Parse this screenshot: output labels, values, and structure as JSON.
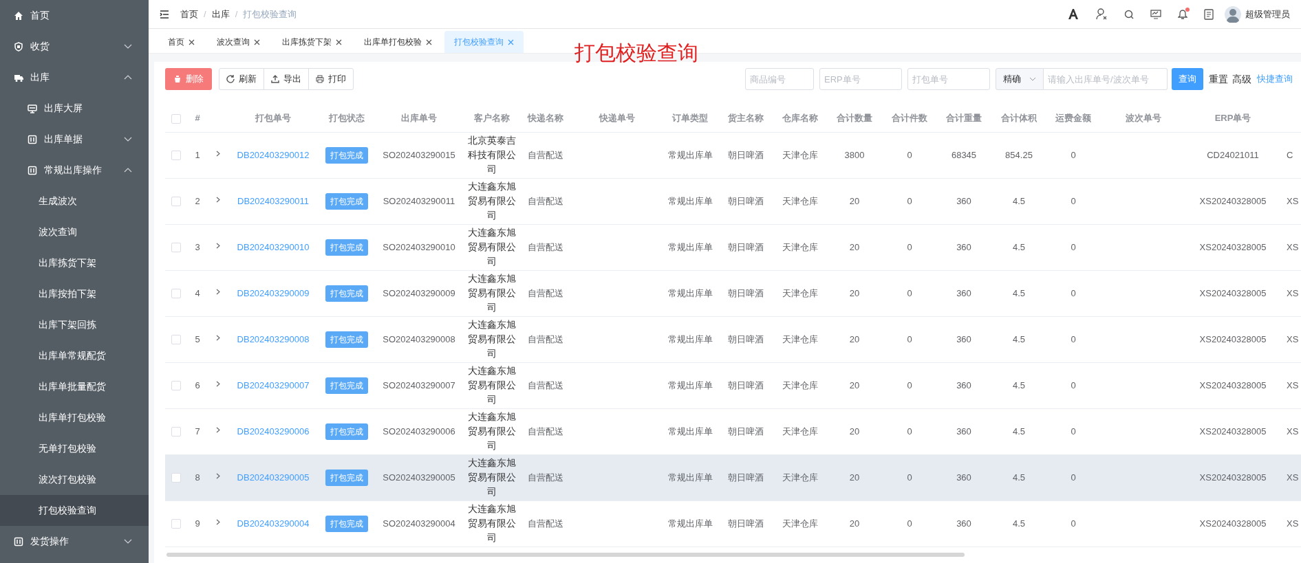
{
  "sidebar": {
    "items": [
      {
        "label": "首页"
      },
      {
        "label": "收货",
        "expanded": false
      },
      {
        "label": "出库",
        "expanded": true,
        "children": [
          {
            "label": "出库大屏"
          },
          {
            "label": "出库单据",
            "expanded": false
          },
          {
            "label": "常规出库操作",
            "expanded": true,
            "children": [
              {
                "label": "生成波次",
                "selected": false
              },
              {
                "label": "波次查询",
                "selected": false
              },
              {
                "label": "出库拣货下架",
                "selected": false
              },
              {
                "label": "出库按拍下架",
                "selected": false
              },
              {
                "label": "出库下架回拣",
                "selected": false
              },
              {
                "label": "出库单常规配货",
                "selected": false
              },
              {
                "label": "出库单批量配货",
                "selected": false
              },
              {
                "label": "出库单打包校验",
                "selected": false
              },
              {
                "label": "无单打包校验",
                "selected": false
              },
              {
                "label": "波次打包校验",
                "selected": false
              },
              {
                "label": "打包校验查询",
                "selected": true
              }
            ]
          }
        ]
      },
      {
        "label": "发货操作",
        "expanded": false
      }
    ]
  },
  "breadcrumb": [
    "首页",
    "出库",
    "打包校验查询"
  ],
  "breadcrumb_separator": "/",
  "user": {
    "name": "超级管理员",
    "notification": true
  },
  "tabs": [
    {
      "label": "首页",
      "selected": false
    },
    {
      "label": "波次查询",
      "selected": false
    },
    {
      "label": "出库拣货下架",
      "selected": false
    },
    {
      "label": "出库单打包校验",
      "selected": false
    },
    {
      "label": "打包校验查询",
      "selected": true
    }
  ],
  "annotation": "打包校验查询",
  "toolbar": {
    "delete": "删除",
    "refresh": "刷新",
    "export": "导出",
    "print": "打印"
  },
  "filters": {
    "product_no": {
      "placeholder": "商品编号"
    },
    "erp_no": {
      "placeholder": "ERP单号"
    },
    "pack_no": {
      "placeholder": "打包单号"
    },
    "match_mode": "精确",
    "keyword": {
      "placeholder": "请输入出库单号/波次单号"
    },
    "search": "查询",
    "reset": "重置",
    "advanced": "高级",
    "quick": "快捷查询"
  },
  "table": {
    "all_checked": false,
    "columns": [
      "#",
      "打包单号",
      "打包状态",
      "出库单号",
      "客户名称",
      "快递名称",
      "快递单号",
      "订单类型",
      "货主名称",
      "仓库名称",
      "合计数量",
      "合计件数",
      "合计重量",
      "合计体积",
      "运费金额",
      "波次单号",
      "ERP单号"
    ],
    "rows": [
      {
        "checked": false,
        "expanded": false,
        "hovered": false,
        "cells": [
          "1",
          "DB202403290012",
          "打包完成",
          "SO202403290015",
          "北京英泰吉科技有限公司",
          "自营配送",
          "",
          "常规出库单",
          "朝日啤酒",
          "天津仓库",
          "3800",
          "0",
          "68345",
          "854.25",
          "0",
          "",
          "CD24021011",
          "C"
        ]
      },
      {
        "checked": false,
        "expanded": false,
        "hovered": false,
        "cells": [
          "2",
          "DB202403290011",
          "打包完成",
          "SO202403290011",
          "大连鑫东旭贸易有限公司",
          "自营配送",
          "",
          "常规出库单",
          "朝日啤酒",
          "天津仓库",
          "20",
          "0",
          "360",
          "4.5",
          "0",
          "",
          "XS20240328005",
          "XS"
        ]
      },
      {
        "checked": false,
        "expanded": false,
        "hovered": false,
        "cells": [
          "3",
          "DB202403290010",
          "打包完成",
          "SO202403290010",
          "大连鑫东旭贸易有限公司",
          "自营配送",
          "",
          "常规出库单",
          "朝日啤酒",
          "天津仓库",
          "20",
          "0",
          "360",
          "4.5",
          "0",
          "",
          "XS20240328005",
          "XS"
        ]
      },
      {
        "checked": false,
        "expanded": false,
        "hovered": false,
        "cells": [
          "4",
          "DB202403290009",
          "打包完成",
          "SO202403290009",
          "大连鑫东旭贸易有限公司",
          "自营配送",
          "",
          "常规出库单",
          "朝日啤酒",
          "天津仓库",
          "20",
          "0",
          "360",
          "4.5",
          "0",
          "",
          "XS20240328005",
          "XS"
        ]
      },
      {
        "checked": false,
        "expanded": false,
        "hovered": false,
        "cells": [
          "5",
          "DB202403290008",
          "打包完成",
          "SO202403290008",
          "大连鑫东旭贸易有限公司",
          "自营配送",
          "",
          "常规出库单",
          "朝日啤酒",
          "天津仓库",
          "20",
          "0",
          "360",
          "4.5",
          "0",
          "",
          "XS20240328005",
          "XS"
        ]
      },
      {
        "checked": false,
        "expanded": false,
        "hovered": false,
        "cells": [
          "6",
          "DB202403290007",
          "打包完成",
          "SO202403290007",
          "大连鑫东旭贸易有限公司",
          "自营配送",
          "",
          "常规出库单",
          "朝日啤酒",
          "天津仓库",
          "20",
          "0",
          "360",
          "4.5",
          "0",
          "",
          "XS20240328005",
          "XS"
        ]
      },
      {
        "checked": false,
        "expanded": false,
        "hovered": false,
        "cells": [
          "7",
          "DB202403290006",
          "打包完成",
          "SO202403290006",
          "大连鑫东旭贸易有限公司",
          "自营配送",
          "",
          "常规出库单",
          "朝日啤酒",
          "天津仓库",
          "20",
          "0",
          "360",
          "4.5",
          "0",
          "",
          "XS20240328005",
          "XS"
        ]
      },
      {
        "checked": false,
        "expanded": false,
        "hovered": true,
        "cells": [
          "8",
          "DB202403290005",
          "打包完成",
          "SO202403290005",
          "大连鑫东旭贸易有限公司",
          "自营配送",
          "",
          "常规出库单",
          "朝日啤酒",
          "天津仓库",
          "20",
          "0",
          "360",
          "4.5",
          "0",
          "",
          "XS20240328005",
          "XS"
        ]
      },
      {
        "checked": false,
        "expanded": false,
        "hovered": false,
        "cells": [
          "9",
          "DB202403290004",
          "打包完成",
          "SO202403290004",
          "大连鑫东旭贸易有限公司",
          "自营配送",
          "",
          "常规出库单",
          "朝日啤酒",
          "天津仓库",
          "20",
          "0",
          "360",
          "4.5",
          "0",
          "",
          "XS20240328005",
          "XS"
        ]
      }
    ]
  }
}
